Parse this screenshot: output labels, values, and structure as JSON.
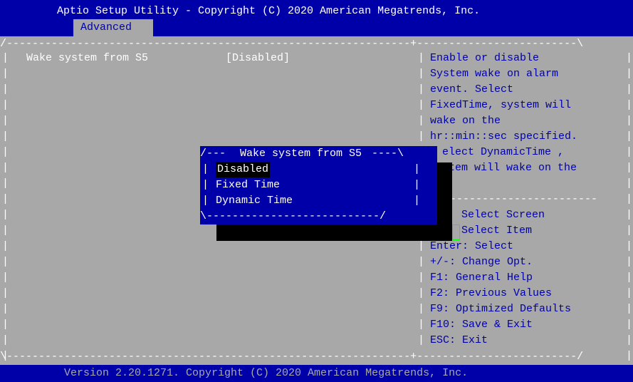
{
  "header": {
    "title": "Aptio Setup Utility - Copyright (C) 2020 American Megatrends, Inc.",
    "active_tab": "Advanced"
  },
  "settings": [
    {
      "label": "Wake system from S5",
      "value": "[Disabled]"
    }
  ],
  "help_text": [
    "Enable or disable",
    "System wake on alarm",
    "event. Select",
    "FixedTime, system will",
    "wake on the",
    "hr::min::sec specified.",
    "elect DynamicTime ,",
    "tem will wake on the"
  ],
  "key_help": [
    "Select Screen",
    "Select Item",
    "Enter: Select",
    "+/-: Change Opt.",
    "F1: General Help",
    "F2: Previous Values",
    "F9: Optimized Defaults",
    "F10: Save & Exit",
    "ESC: Exit"
  ],
  "popup": {
    "title": "Wake system from S5",
    "options": [
      "Disabled",
      "Fixed Time",
      "Dynamic Time"
    ],
    "selected_index": 0
  },
  "footer": {
    "text": "Version 2.20.1271. Copyright (C) 2020 American Megatrends, Inc."
  },
  "colors": {
    "background_blue": "#0000a8",
    "panel_gray": "#a8a8a8",
    "highlight_black": "#000000",
    "text_white": "#ffffff"
  }
}
